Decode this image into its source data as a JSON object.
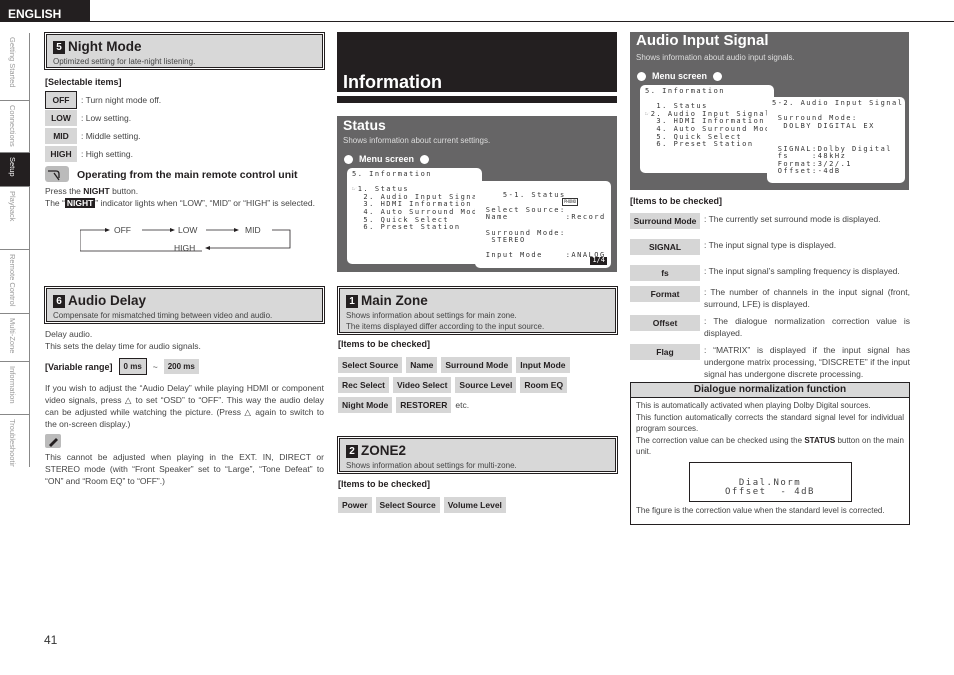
{
  "header": {
    "language": "ENGLISH"
  },
  "side_tabs": [
    {
      "label": "Getting Started",
      "active": false
    },
    {
      "label": "Connections",
      "active": false
    },
    {
      "label": "Setup",
      "active": true
    },
    {
      "label": "Playback",
      "active": false
    },
    {
      "label": "Remote Control",
      "active": false
    },
    {
      "label": "Multi-Zone",
      "active": false
    },
    {
      "label": "Information",
      "active": false
    },
    {
      "label": "Troubleshooting",
      "active": false
    }
  ],
  "night_mode": {
    "number": "5",
    "title": "Night Mode",
    "subtitle": "Optimized setting for late-night listening.",
    "selectable_label": "[Selectable items]",
    "items": [
      {
        "badge": "OFF",
        "desc": ": Turn night mode off."
      },
      {
        "badge": "LOW",
        "desc": ": Low setting."
      },
      {
        "badge": "MID",
        "desc": ": Middle setting."
      },
      {
        "badge": "HIGH",
        "desc": ": High setting."
      }
    ],
    "remote_heading": "Operating from the main remote control unit",
    "press_prefix": "Press the ",
    "press_button": "NIGHT",
    "press_suffix": " button.",
    "indicator_prefix": "The “",
    "indicator_name": "NIGHT",
    "indicator_suffix": "” indicator lights when “LOW”, “MID” or “HIGH” is selected.",
    "cycle": {
      "off": "OFF",
      "low": "LOW",
      "mid": "MID",
      "high": "HIGH"
    }
  },
  "audio_delay": {
    "number": "6",
    "title": "Audio Delay",
    "subtitle": "Compensate for mismatched timing between video and audio.",
    "line1": "Delay audio.",
    "line2": "This sets the delay time for audio signals.",
    "range_label": "[Variable range]",
    "range_min": "0 ms",
    "range_sep": "~",
    "range_max": "200 ms",
    "paragraph": "If you wish to adjust the “Audio Delay” while playing HDMI or component video signals, press △ to set “OSD” to “OFF”. This way the audio delay can be adjusted while watching the picture. (Press △ again to switch to the on-screen display.)",
    "note": "This cannot be adjusted when playing in the EXT. IN, DIRECT or STEREO mode (with “Front Speaker” set to “Large”, “Tone Defeat” to “ON” and “Room EQ” to “OFF”.)"
  },
  "information": {
    "title": "Information"
  },
  "status": {
    "title": "Status",
    "subtitle": "Shows information about current settings.",
    "menu_label": "Menu screen",
    "osd_menu": "5. Information\n\n☞1. Status\n  2. Audio Input Signal\n  3. HDMI Information\n  4. Auto Surround Mode\n  5. Quick Select\n  6. Preset Station",
    "osd_detail": "5-1. Status\n\n Select Source:\n Name          :Record\n\n Surround Mode:\n  STEREO\n\n Input Mode    :ANALOG",
    "phono": "PHONO",
    "page": "1/4"
  },
  "main_zone": {
    "number": "1",
    "title": "Main Zone",
    "subtitle1": "Shows information about settings for main zone.",
    "subtitle2": "The items displayed differ according to the input source.",
    "items_label": "[Items to be checked]",
    "items": [
      [
        "Select Source",
        "Name",
        "Surround Mode",
        "Input Mode"
      ],
      [
        "Rec Select",
        "Video Select",
        "Source Level",
        "Room EQ"
      ],
      [
        "Night Mode",
        "RESTORER"
      ]
    ],
    "etc": "etc."
  },
  "zone2": {
    "number": "2",
    "title": "ZONE2",
    "subtitle": "Shows information about settings for multi-zone.",
    "items_label": "[Items to be checked]",
    "items": [
      "Power",
      "Select Source",
      "Volume Level"
    ]
  },
  "audio_input_signal": {
    "title": "Audio Input Signal",
    "subtitle": "Shows information about audio input signals.",
    "menu_label": "Menu screen",
    "osd_menu": "5. Information\n\n  1. Status\n☞2. Audio Input Signal\n  3. HDMI Information\n  4. Auto Surround Mode\n  5. Quick Select\n  6. Preset Station",
    "osd_detail": "5-2. Audio Input Signal\n\n Surround Mode:\n  DOLBY DIGITAL EX\n\n\n SIGNAL:Dolby Digital\n fs    :48kHz\n Format:3/2/.1\n Offset:-4dB",
    "items_label": "[Items to be checked]",
    "items": [
      {
        "badge": "Surround Mode",
        "desc": ": The currently set surround mode is displayed."
      },
      {
        "badge": "SIGNAL",
        "desc": ": The input signal type is displayed."
      },
      {
        "badge": "fs",
        "desc": ": The input signal’s sampling frequency is displayed."
      },
      {
        "badge": "Format",
        "desc": ": The number of channels in the input signal (front, surround, LFE) is displayed."
      },
      {
        "badge": "Offset",
        "desc": ": The dialogue normalization correction value is displayed."
      },
      {
        "badge": "Flag",
        "desc": ": “MATRIX” is displayed if the input signal has undergone matrix processing, “DISCRETE” if the input signal has undergone discrete processing."
      }
    ]
  },
  "dialnorm": {
    "title": "Dialogue normalization function",
    "p1": "This is automatically activated when playing Dolby Digital sources.",
    "p2": "This function automatically corrects the standard signal level for individual program sources.",
    "p3_prefix": "The correction value can be checked using the ",
    "p3_button": "STATUS",
    "p3_suffix": " button on the main unit.",
    "display_line1": "Dial.Norm",
    "display_line2": "Offset  - 4dB",
    "p4": "The figure is the correction value when the standard level is corrected."
  },
  "footer": {
    "page_number": "41"
  }
}
